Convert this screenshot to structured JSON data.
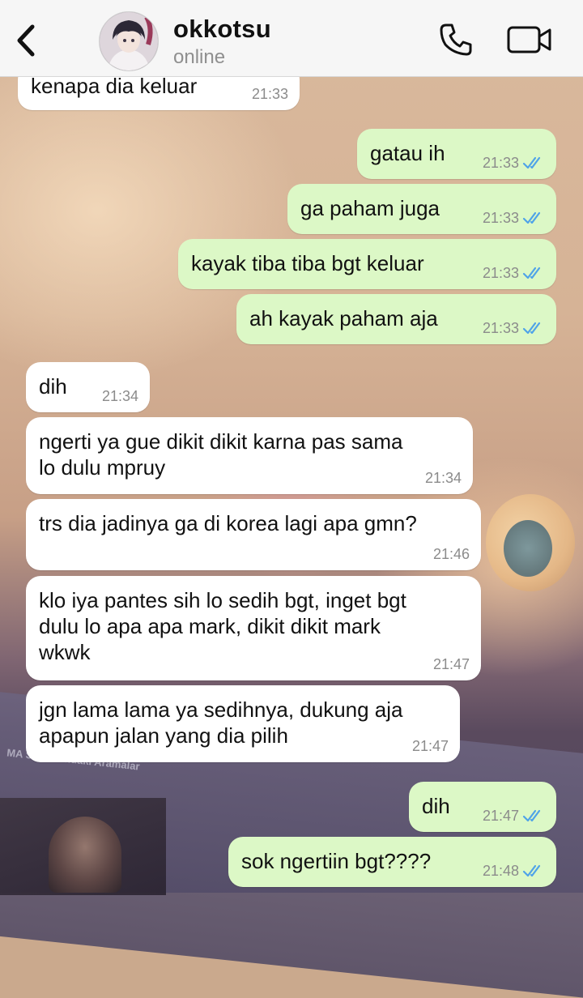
{
  "header": {
    "back_label": "Back",
    "name": "okkotsu",
    "status": "online",
    "call_label": "Voice call",
    "video_label": "Video call"
  },
  "wallpaper": {
    "text": "MA SO Yakındaki Aramalar"
  },
  "colors": {
    "outgoing_bubble": "#dcf8c6",
    "incoming_bubble": "#ffffff",
    "read_tick": "#4fa3e8",
    "header_bg": "#f6f6f6"
  },
  "messages": [
    {
      "dir": "in",
      "text": "kenapa dia keluar",
      "time": "21:33"
    },
    {
      "dir": "out",
      "text": "gatau ih",
      "time": "21:33",
      "status": "read"
    },
    {
      "dir": "out",
      "text": "ga paham juga",
      "time": "21:33",
      "status": "read"
    },
    {
      "dir": "out",
      "text": "kayak tiba tiba bgt keluar",
      "time": "21:33",
      "status": "read"
    },
    {
      "dir": "out",
      "text": "ah kayak paham aja",
      "time": "21:33",
      "status": "read"
    },
    {
      "dir": "in",
      "text": "dih",
      "time": "21:34"
    },
    {
      "dir": "in",
      "text": "ngerti ya gue dikit dikit karna pas sama\nlo dulu mpruy",
      "time": "21:34"
    },
    {
      "dir": "in",
      "text": "trs dia jadinya ga di korea lagi apa gmn?",
      "time": "21:46"
    },
    {
      "dir": "in",
      "text": "klo iya pantes sih lo sedih bgt, inget bgt\ndulu lo apa apa mark, dikit dikit mark\nwkwk",
      "time": "21:47"
    },
    {
      "dir": "in",
      "text": "jgn lama lama ya sedihnya, dukung aja\napapun jalan yang dia pilih",
      "time": "21:47"
    },
    {
      "dir": "out",
      "text": "dih",
      "time": "21:47",
      "status": "read"
    },
    {
      "dir": "out",
      "text": "sok ngertiin bgt????",
      "time": "21:48",
      "status": "read"
    }
  ]
}
